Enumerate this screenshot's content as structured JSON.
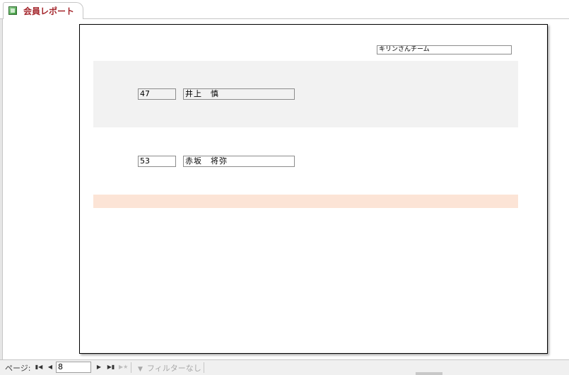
{
  "tab": {
    "title": "会員レポート",
    "icon": "report-icon"
  },
  "report": {
    "team_name": "キリンさんチーム",
    "records": [
      {
        "id": "47",
        "name": "井上　慎"
      },
      {
        "id": "53",
        "name": "赤坂　将弥"
      }
    ],
    "colors": {
      "alt_band": "#f2f2f2",
      "footer_band": "#fce4d6"
    }
  },
  "navigation": {
    "page_label": "ページ:",
    "current_page": "8",
    "filter_label": "フィルターなし",
    "icons": {
      "first": "first-page-icon",
      "prev": "prev-page-icon",
      "next": "next-page-icon",
      "last": "last-page-icon",
      "new": "new-record-icon",
      "filter": "filter-icon"
    }
  },
  "accent_color": "#a4262c"
}
